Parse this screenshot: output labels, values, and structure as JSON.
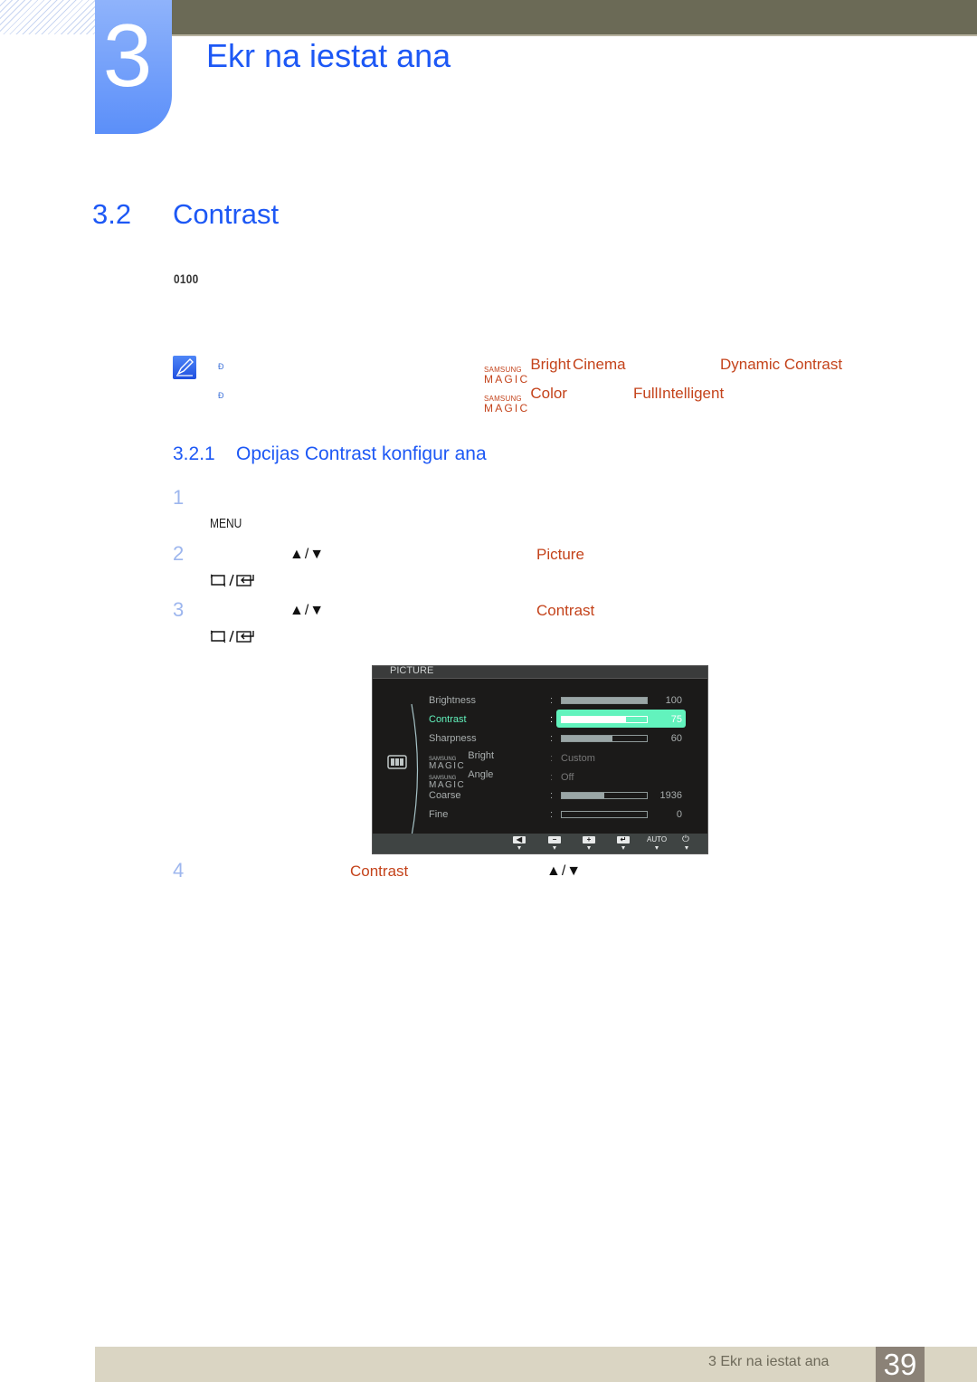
{
  "header": {
    "chapter_number": "3",
    "chapter_title": "Ekr na iestat  ana"
  },
  "section": {
    "number": "3.2",
    "title": "Contrast",
    "model_code": "0100"
  },
  "note": {
    "icon": "note-pencil-icon",
    "bullet": "Ð",
    "lines": [
      {
        "magic_prefix_top": "SAMSUNG",
        "magic_prefix_bottom": "MAGIC",
        "magic_term": "Bright",
        "term_2": "Cinema",
        "term_3": "Dynamic Contrast"
      },
      {
        "magic_prefix_top": "SAMSUNG",
        "magic_prefix_bottom": "MAGIC",
        "magic_term": "Color",
        "term_2": "Full",
        "term_3": "Intelligent"
      }
    ]
  },
  "subsection": {
    "number": "3.2.1",
    "title": "Opcijas Contrast konfigur  ana"
  },
  "steps": [
    {
      "number": "1",
      "key": "MENU"
    },
    {
      "number": "2",
      "arrows": "▲/▼",
      "target": "Picture",
      "confirm_keys": "source/enter"
    },
    {
      "number": "3",
      "arrows": "▲/▼",
      "target": "Contrast",
      "confirm_keys": "source/enter"
    },
    {
      "number": "4",
      "target": "Contrast",
      "arrows": "▲/▼"
    }
  ],
  "osd": {
    "title": "PICTURE",
    "category_icon": "picture-menu-icon",
    "rows": [
      {
        "label": "Brightness",
        "type": "bar",
        "value": "100",
        "fill_fraction": 1.0,
        "selected": false
      },
      {
        "label": "Contrast",
        "type": "bar",
        "value": "75",
        "fill_fraction": 0.75,
        "selected": true
      },
      {
        "label": "Sharpness",
        "type": "bar",
        "value": "60",
        "fill_fraction": 0.6,
        "selected": false
      },
      {
        "magic_top": "SAMSUNG",
        "magic_bottom": "MAGIC",
        "label": "Bright",
        "type": "text",
        "value": "Custom",
        "selected": false
      },
      {
        "magic_top": "SAMSUNG",
        "magic_bottom": "MAGIC",
        "label": "Angle",
        "type": "text",
        "value": "Off",
        "selected": false
      },
      {
        "label": "Coarse",
        "type": "bar",
        "value": "1936",
        "fill_fraction": 0.5,
        "selected": false
      },
      {
        "label": "Fine",
        "type": "bar",
        "value": "0",
        "fill_fraction": 0.0,
        "selected": false
      }
    ],
    "footer_buttons": [
      {
        "name": "left-button",
        "glyph": "◀"
      },
      {
        "name": "minus-button",
        "glyph": "−"
      },
      {
        "name": "plus-button",
        "glyph": "+"
      },
      {
        "name": "enter-button",
        "glyph": "↵"
      },
      {
        "name": "auto-button",
        "glyph": "AUTO"
      },
      {
        "name": "power-button",
        "glyph": "⏻"
      }
    ]
  },
  "footer": {
    "chapter_label": "3 Ekr na iestat  ana",
    "page_number": "39"
  }
}
